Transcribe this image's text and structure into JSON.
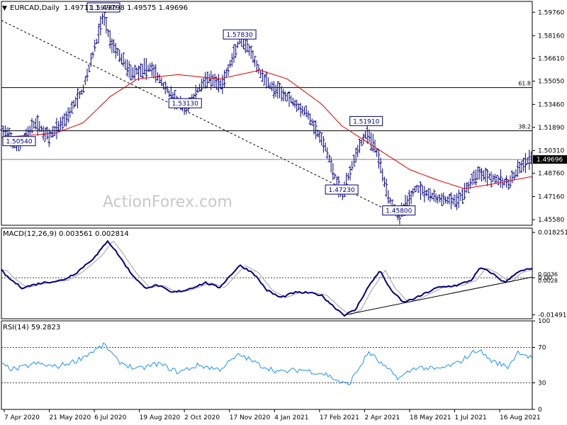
{
  "chart_data": [
    {
      "panel": "price",
      "type": "ohlc",
      "header": {
        "symbol_label": "EURCAD,Daily",
        "ohlc_text": "1.49711 1.49798 1.49575 1.49696"
      },
      "watermark": "ActionForex.com",
      "ylim": [
        1.452,
        1.605
      ],
      "y_ticks": [
        "1.59760",
        "1.58160",
        "1.56610",
        "1.55050",
        "1.53460",
        "1.51890",
        "1.50310",
        "1.48760",
        "1.47160",
        "1.45580"
      ],
      "current_price_label": "1.49696",
      "current_price": 1.49696,
      "path_anchors": [
        {
          "d": 0,
          "v": 1.518
        },
        {
          "d": 12,
          "v": 1.505
        },
        {
          "d": 25,
          "v": 1.522
        },
        {
          "d": 35,
          "v": 1.512
        },
        {
          "d": 48,
          "v": 1.526
        },
        {
          "d": 60,
          "v": 1.545
        },
        {
          "d": 70,
          "v": 1.578
        },
        {
          "d": 75,
          "v": 1.596
        },
        {
          "d": 80,
          "v": 1.578
        },
        {
          "d": 95,
          "v": 1.556
        },
        {
          "d": 110,
          "v": 1.56
        },
        {
          "d": 125,
          "v": 1.54
        },
        {
          "d": 135,
          "v": 1.531
        },
        {
          "d": 150,
          "v": 1.552
        },
        {
          "d": 162,
          "v": 1.548
        },
        {
          "d": 175,
          "v": 1.578
        },
        {
          "d": 182,
          "v": 1.572
        },
        {
          "d": 190,
          "v": 1.556
        },
        {
          "d": 200,
          "v": 1.545
        },
        {
          "d": 210,
          "v": 1.54
        },
        {
          "d": 225,
          "v": 1.528
        },
        {
          "d": 238,
          "v": 1.505
        },
        {
          "d": 250,
          "v": 1.472
        },
        {
          "d": 260,
          "v": 1.5
        },
        {
          "d": 268,
          "v": 1.515
        },
        {
          "d": 275,
          "v": 1.505
        },
        {
          "d": 285,
          "v": 1.47
        },
        {
          "d": 292,
          "v": 1.458
        },
        {
          "d": 305,
          "v": 1.478
        },
        {
          "d": 320,
          "v": 1.47
        },
        {
          "d": 335,
          "v": 1.468
        },
        {
          "d": 350,
          "v": 1.488
        },
        {
          "d": 360,
          "v": 1.485
        },
        {
          "d": 372,
          "v": 1.48
        },
        {
          "d": 382,
          "v": 1.492
        },
        {
          "d": 388,
          "v": 1.497
        }
      ],
      "ma_anchors": [
        {
          "d": 0,
          "v": 1.512
        },
        {
          "d": 40,
          "v": 1.515
        },
        {
          "d": 60,
          "v": 1.522
        },
        {
          "d": 80,
          "v": 1.54
        },
        {
          "d": 100,
          "v": 1.552
        },
        {
          "d": 130,
          "v": 1.555
        },
        {
          "d": 160,
          "v": 1.552
        },
        {
          "d": 190,
          "v": 1.558
        },
        {
          "d": 210,
          "v": 1.552
        },
        {
          "d": 235,
          "v": 1.535
        },
        {
          "d": 250,
          "v": 1.52
        },
        {
          "d": 275,
          "v": 1.505
        },
        {
          "d": 300,
          "v": 1.49
        },
        {
          "d": 320,
          "v": 1.483
        },
        {
          "d": 340,
          "v": 1.477
        },
        {
          "d": 360,
          "v": 1.48
        },
        {
          "d": 388,
          "v": 1.485
        }
      ],
      "annotations": [
        {
          "text": "1.59780",
          "d": 75,
          "v": 1.5978
        },
        {
          "text": "1.57830",
          "d": 175,
          "v": 1.5783
        },
        {
          "text": "1.53130",
          "d": 135,
          "v": 1.5313
        },
        {
          "text": "1.50540",
          "d": 12,
          "v": 1.5054
        },
        {
          "text": "1.51910",
          "d": 268,
          "v": 1.5191
        },
        {
          "text": "1.47230",
          "d": 250,
          "v": 1.4723
        },
        {
          "text": "1.45800",
          "d": 292,
          "v": 1.458
        }
      ],
      "fib_lines": [
        {
          "label": "61.8",
          "value": 1.5461
        },
        {
          "label": "38.2",
          "value": 1.5166
        }
      ],
      "trendline": {
        "from": {
          "d": 0,
          "v": 1.592
        },
        "to": {
          "d": 292,
          "v": 1.4585
        }
      }
    },
    {
      "panel": "macd",
      "type": "line",
      "header": "MACD(12,26,9) 0.003561 0.002814",
      "ylim": [
        -0.0165,
        0.02
      ],
      "y_ticks": [
        "0.018251",
        "0.00",
        "-0.01491"
      ],
      "current_labels": [
        "0.0036",
        "0.0028"
      ],
      "macd_anchors": [
        {
          "d": 0,
          "v": 0.003
        },
        {
          "d": 5,
          "v": 0.0
        },
        {
          "d": 15,
          "v": -0.004
        },
        {
          "d": 30,
          "v": -0.002
        },
        {
          "d": 45,
          "v": -0.001
        },
        {
          "d": 55,
          "v": 0.002
        },
        {
          "d": 70,
          "v": 0.009
        },
        {
          "d": 78,
          "v": 0.015
        },
        {
          "d": 85,
          "v": 0.01
        },
        {
          "d": 95,
          "v": 0.002
        },
        {
          "d": 105,
          "v": -0.004
        },
        {
          "d": 115,
          "v": -0.003
        },
        {
          "d": 125,
          "v": -0.006
        },
        {
          "d": 135,
          "v": -0.005
        },
        {
          "d": 150,
          "v": -0.002
        },
        {
          "d": 160,
          "v": -0.004
        },
        {
          "d": 175,
          "v": 0.005
        },
        {
          "d": 185,
          "v": 0.002
        },
        {
          "d": 195,
          "v": -0.005
        },
        {
          "d": 205,
          "v": -0.008
        },
        {
          "d": 215,
          "v": -0.006
        },
        {
          "d": 225,
          "v": -0.006
        },
        {
          "d": 235,
          "v": -0.007
        },
        {
          "d": 245,
          "v": -0.012
        },
        {
          "d": 252,
          "v": -0.015
        },
        {
          "d": 260,
          "v": -0.013
        },
        {
          "d": 268,
          "v": -0.005
        },
        {
          "d": 278,
          "v": 0.003
        },
        {
          "d": 285,
          "v": -0.004
        },
        {
          "d": 295,
          "v": -0.01
        },
        {
          "d": 305,
          "v": -0.008
        },
        {
          "d": 320,
          "v": -0.004
        },
        {
          "d": 335,
          "v": -0.003
        },
        {
          "d": 345,
          "v": -0.001
        },
        {
          "d": 352,
          "v": 0.004
        },
        {
          "d": 360,
          "v": 0.002
        },
        {
          "d": 370,
          "v": -0.002
        },
        {
          "d": 378,
          "v": 0.002
        },
        {
          "d": 388,
          "v": 0.0036
        }
      ],
      "signal_lag": 4,
      "trendline": {
        "from": {
          "d": 252,
          "v": -0.015
        },
        "to": {
          "d": 390,
          "v": 0.0003
        }
      }
    },
    {
      "panel": "rsi",
      "type": "line",
      "header": "RSI(14) 59.2823",
      "ylim": [
        0,
        100
      ],
      "y_ticks": [
        "100",
        "70",
        "30",
        "0"
      ],
      "levels": [
        70,
        30
      ],
      "rsi_anchors": [
        {
          "d": 0,
          "v": 50
        },
        {
          "d": 10,
          "v": 45
        },
        {
          "d": 25,
          "v": 52
        },
        {
          "d": 40,
          "v": 48
        },
        {
          "d": 55,
          "v": 55
        },
        {
          "d": 70,
          "v": 68
        },
        {
          "d": 76,
          "v": 73
        },
        {
          "d": 85,
          "v": 55
        },
        {
          "d": 100,
          "v": 45
        },
        {
          "d": 115,
          "v": 52
        },
        {
          "d": 130,
          "v": 42
        },
        {
          "d": 145,
          "v": 50
        },
        {
          "d": 160,
          "v": 45
        },
        {
          "d": 175,
          "v": 62
        },
        {
          "d": 190,
          "v": 50
        },
        {
          "d": 205,
          "v": 42
        },
        {
          "d": 220,
          "v": 45
        },
        {
          "d": 238,
          "v": 40
        },
        {
          "d": 250,
          "v": 30
        },
        {
          "d": 255,
          "v": 28
        },
        {
          "d": 262,
          "v": 45
        },
        {
          "d": 270,
          "v": 65
        },
        {
          "d": 280,
          "v": 50
        },
        {
          "d": 292,
          "v": 35
        },
        {
          "d": 305,
          "v": 48
        },
        {
          "d": 320,
          "v": 45
        },
        {
          "d": 335,
          "v": 52
        },
        {
          "d": 350,
          "v": 68
        },
        {
          "d": 360,
          "v": 55
        },
        {
          "d": 372,
          "v": 48
        },
        {
          "d": 380,
          "v": 66
        },
        {
          "d": 388,
          "v": 59
        }
      ]
    }
  ],
  "x_axis": {
    "range_days": [
      0,
      390
    ],
    "labels": [
      {
        "text": "7 Apr 2020",
        "d": 0
      },
      {
        "text": "21 May 2020",
        "d": 44
      },
      {
        "text": "6 Jul 2020",
        "d": 90
      },
      {
        "text": "19 Aug 2020",
        "d": 134
      },
      {
        "text": "2 Oct 2020",
        "d": 178
      },
      {
        "text": "17 Nov 2020",
        "d": 224
      },
      {
        "text": "4 Jan 2021",
        "d": 272
      },
      {
        "text": "17 Feb 2021",
        "d": 316
      },
      {
        "text": "2 Apr 2021",
        "d": 360
      },
      {
        "text": "18 May 2021",
        "d": 406
      },
      {
        "text": "1 Jul 2021",
        "d": 450
      },
      {
        "text": "16 Aug 2021",
        "d": 496
      }
    ]
  },
  "colors": {
    "price_bar": "#000080",
    "moving_average": "#dd0000",
    "annotation_border": "#000080",
    "macd_line": "#000080",
    "signal_line": "#a0a0a0",
    "rsi_line": "#1e90ff",
    "grid": "#000000",
    "watermark": "#c8c8c8"
  }
}
